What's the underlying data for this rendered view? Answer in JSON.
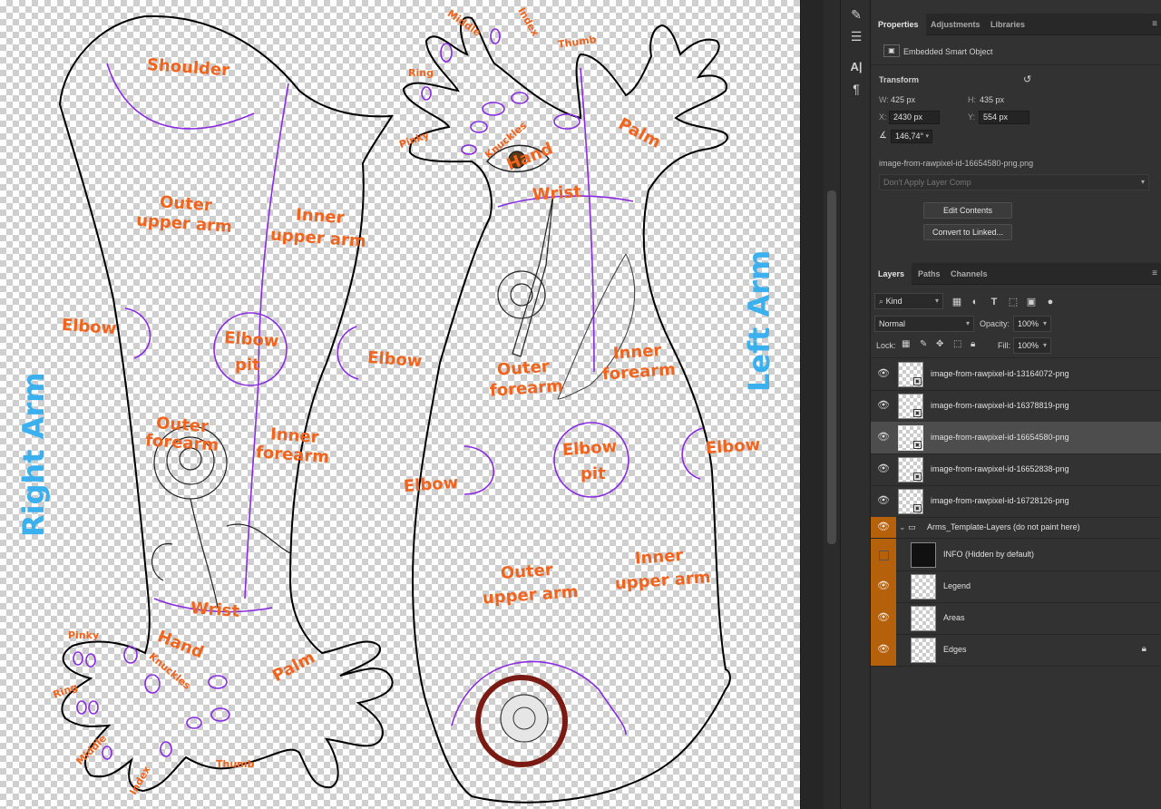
{
  "canvas": {
    "labels": {
      "shoulder": "Shoulder",
      "outer_upper_arm_l1": "Outer",
      "outer_upper_arm_l2": "upper arm",
      "inner_upper_arm_l1": "Inner",
      "inner_upper_arm_l2": "upper arm",
      "elbow": "Elbow",
      "elbow_pit_l1": "Elbow",
      "elbow_pit_l2": "pit",
      "outer_forearm_l1": "Outer",
      "outer_forearm_l2": "forearm",
      "inner_forearm_l1": "Inner",
      "inner_forearm_l2": "forearm",
      "wrist": "Wrist",
      "hand": "Hand",
      "palm": "Palm",
      "knuckles": "Knuckles",
      "pinky": "Pinky",
      "ring": "Ring",
      "middle": "Middle",
      "index": "Index",
      "thumb": "Thumb",
      "right_arm": "Right Arm",
      "left_arm": "Left Arm"
    },
    "colors": {
      "label": "#f0641e",
      "side_label": "#3ab0ee",
      "area_lines": "#8a2be2",
      "edges": "#000000"
    }
  },
  "toolstrip": {
    "icons": [
      "brush-settings-icon",
      "adjustment-sliders-icon",
      "character-icon",
      "paragraph-icon"
    ]
  },
  "properties": {
    "tabs": [
      "Properties",
      "Adjustments",
      "Libraries"
    ],
    "active_tab": "Properties",
    "object_type": "Embedded Smart Object",
    "transform_title": "Transform",
    "w_label": "W:",
    "w_value": "425 px",
    "h_label": "H:",
    "h_value": "435 px",
    "x_label": "X:",
    "x_value": "2430 px",
    "y_label": "Y:",
    "y_value": "554 px",
    "angle_value": "146,74°",
    "file_name": "image-from-rawpixel-id-16654580-png.png",
    "layer_comp": "Don't Apply Layer Comp",
    "edit_contents": "Edit Contents",
    "convert_linked": "Convert to Linked..."
  },
  "layers_panel": {
    "tabs": [
      "Layers",
      "Paths",
      "Channels"
    ],
    "active_tab": "Layers",
    "filter_kind": "Kind",
    "blend_mode": "Normal",
    "opacity_label": "Opacity:",
    "opacity_value": "100%",
    "lock_label": "Lock:",
    "fill_label": "Fill:",
    "fill_value": "100%",
    "layers": [
      {
        "name": "image-from-rawpixel-id-13164072-png",
        "visible": true,
        "selected": false
      },
      {
        "name": "image-from-rawpixel-id-16378819-png",
        "visible": true,
        "selected": false
      },
      {
        "name": "image-from-rawpixel-id-16654580-png",
        "visible": true,
        "selected": true
      },
      {
        "name": "image-from-rawpixel-id-16652838-png",
        "visible": true,
        "selected": false
      },
      {
        "name": "image-from-rawpixel-id-16728126-png",
        "visible": true,
        "selected": false
      },
      {
        "name": "Arms_Template-Layers (do not paint here)",
        "visible": true,
        "group": true
      },
      {
        "name": "INFO (Hidden by default)",
        "visible": false
      },
      {
        "name": "Legend",
        "visible": true
      },
      {
        "name": "Areas",
        "visible": true
      },
      {
        "name": "Edges",
        "visible": true,
        "locked": true
      }
    ]
  }
}
